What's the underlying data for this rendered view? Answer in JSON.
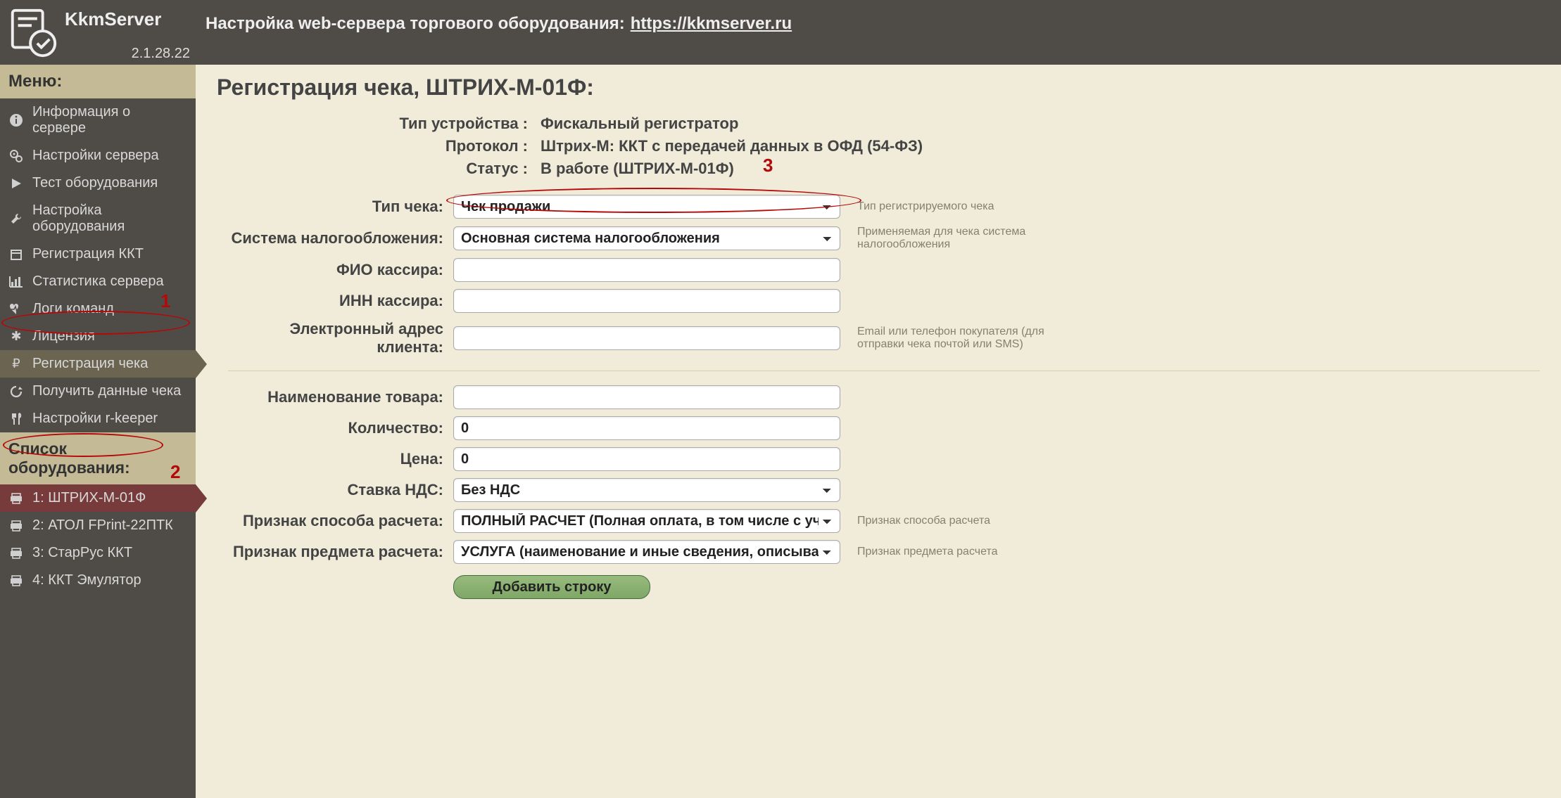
{
  "app": {
    "title": "KkmServer",
    "version": "2.1.28.22"
  },
  "header": {
    "prefix": "Настройка web-сервера торгового оборудования:",
    "link_text": "https://kkmserver.ru"
  },
  "sidebar": {
    "menu_header": "Меню:",
    "items": [
      {
        "label": "Информация о сервере",
        "icon": "info-circle-icon"
      },
      {
        "label": "Настройки сервера",
        "icon": "gears-icon"
      },
      {
        "label": "Тест оборудования",
        "icon": "play-icon"
      },
      {
        "label": "Настройка оборудования",
        "icon": "wrench-icon"
      },
      {
        "label": "Регистрация ККТ",
        "icon": "calendar-icon"
      },
      {
        "label": "Статистика сервера",
        "icon": "bar-chart-icon"
      },
      {
        "label": "Логи команд",
        "icon": "heartbeat-icon"
      },
      {
        "label": "Лицензия",
        "icon": "asterisk-icon"
      },
      {
        "label": "Регистрация чека",
        "icon": "ruble-icon"
      },
      {
        "label": "Получить данные чека",
        "icon": "refresh-icon"
      },
      {
        "label": "Настройки r-keeper",
        "icon": "cutlery-icon"
      }
    ],
    "equip_header": "Список оборудования:",
    "equipment": [
      {
        "label": "1: ШТРИХ-М-01Ф"
      },
      {
        "label": "2: АТОЛ FPrint-22ПТК"
      },
      {
        "label": "3: СтарРус ККТ"
      },
      {
        "label": "4: ККТ Эмулятор"
      }
    ]
  },
  "main": {
    "title": "Регистрация чека, ШТРИХ-М-01Ф:",
    "info": {
      "device_type_label": "Тип устройства :",
      "device_type_value": "Фискальный регистратор",
      "protocol_label": "Протокол :",
      "protocol_value": "Штрих-М: ККТ с передачей данных в ОФД (54-ФЗ)",
      "status_label": "Статус :",
      "status_value": "В работе (ШТРИХ-М-01Ф)"
    },
    "form": {
      "receipt_type": {
        "label": "Тип чека:",
        "value": "Чек продажи",
        "help": "Тип регистрируемого чека"
      },
      "tax_system": {
        "label": "Система налогообложения:",
        "value": "Основная система налогообложения",
        "help": "Применяемая для чека система налогообложения"
      },
      "cashier_name": {
        "label": "ФИО кассира:",
        "value": ""
      },
      "cashier_inn": {
        "label": "ИНН кассира:",
        "value": ""
      },
      "client_email": {
        "label": "Электронный адрес клиента:",
        "value": "",
        "help": "Email или телефон покупателя (для отправки чека почтой или SMS)"
      },
      "product_name": {
        "label": "Наименование товара:",
        "value": ""
      },
      "quantity": {
        "label": "Количество:",
        "value": "0"
      },
      "price": {
        "label": "Цена:",
        "value": "0"
      },
      "vat": {
        "label": "Ставка НДС:",
        "value": "Без НДС"
      },
      "payment_method": {
        "label": "Признак способа расчета:",
        "value": "ПОЛНЫЙ РАСЧЕТ (Полная оплата, в том числе с учетом",
        "help": "Признак способа расчета"
      },
      "payment_subject": {
        "label": "Признак предмета расчета:",
        "value": "УСЛУГА (наименование и иные сведения, описывающие",
        "help": "Признак предмета расчета"
      },
      "add_row_button": "Добавить строку"
    }
  },
  "annotations": {
    "m1": "1",
    "m2": "2",
    "m3": "3"
  }
}
